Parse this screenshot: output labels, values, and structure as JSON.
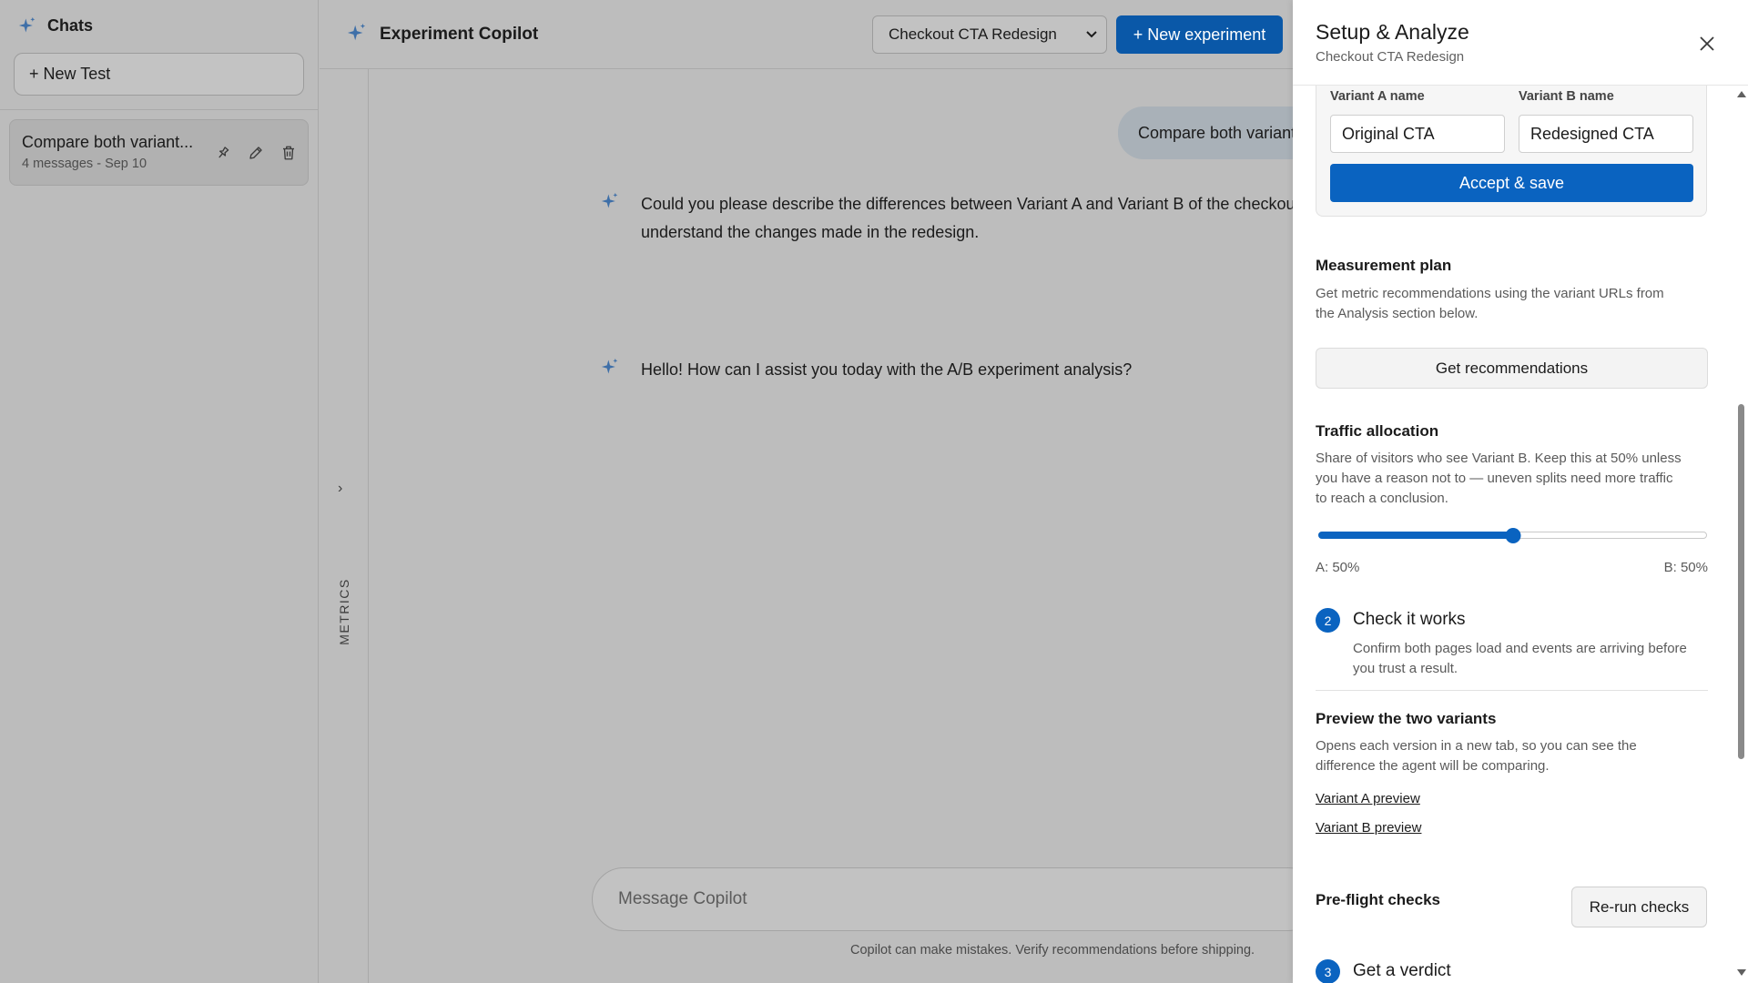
{
  "colors": {
    "accent": "#0a63c0",
    "header_button": "#0a58a8",
    "spark": "#3e6fa8"
  },
  "sidebar": {
    "title": "Chats",
    "new_test_label": "+ New Test",
    "chats": [
      {
        "title": "Compare both variant...",
        "meta": "4 messages - Sep 10",
        "icons": [
          "pin-icon",
          "pencil-icon",
          "trash-icon"
        ]
      }
    ]
  },
  "rail": {
    "label": "METRICS",
    "chevron": "›"
  },
  "header": {
    "title": "Experiment Copilot",
    "experiment_select": {
      "selected": "Checkout CTA Redesign"
    },
    "new_experiment_label": "+ New experiment"
  },
  "conversation": {
    "user_message": "Compare both variants",
    "assistant_messages": [
      {
        "lines": [
          "Could you please describe the differences between Variant A and Variant B of the checkout CTA so I can",
          "understand the changes made in the redesign."
        ]
      },
      {
        "lines": [
          "Hello! How can I assist you today with the A/B experiment analysis?"
        ]
      }
    ],
    "composer_placeholder": "Message Copilot",
    "disclaimer": "Copilot can make mistakes. Verify recommendations before shipping."
  },
  "panel": {
    "title": "Setup & Analyze",
    "subtitle": "Checkout CTA Redesign",
    "variants": {
      "a_label": "Variant A name",
      "a_value": "Original CTA",
      "b_label": "Variant B name",
      "b_value": "Redesigned CTA",
      "accept_label": "Accept & save"
    },
    "measurement": {
      "title": "Measurement plan",
      "desc_lines": [
        "Get metric recommendations using the variant URLs from",
        "the Analysis section below."
      ],
      "button": "Get recommendations"
    },
    "traffic": {
      "title": "Traffic allocation",
      "desc_lines": [
        "Share of visitors who see Variant B. Keep this at 50% unless",
        "you have a reason not to — uneven splits need more traffic",
        "to reach a conclusion."
      ],
      "split_b_percent": 50,
      "label_a": "A: 50%",
      "label_b": "B: 50%"
    },
    "step2": {
      "number": "2",
      "title": "Check it works",
      "desc_lines": [
        "Confirm both pages load and events are arriving before",
        "you trust a result."
      ]
    },
    "preview": {
      "title": "Preview the two variants",
      "desc_lines": [
        "Opens each version in a new tab, so you can see the",
        "difference the agent will be comparing."
      ],
      "link_a": "Variant A preview",
      "link_b": "Variant B preview"
    },
    "preflight": {
      "title": "Pre-flight checks",
      "button": "Re-run checks"
    },
    "step3": {
      "number": "3",
      "title": "Get a verdict"
    }
  }
}
